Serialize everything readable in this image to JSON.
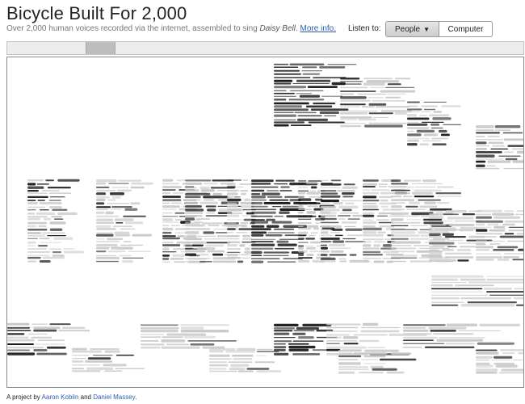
{
  "header": {
    "title": "Bicycle Built For 2,000",
    "subtitle_prefix": "Over 2,000 human voices recorded via the internet, assembled to sing ",
    "subtitle_song": "Daisy Bell",
    "subtitle_period": ".",
    "more_info_link": "More info."
  },
  "listen": {
    "label": "Listen to:",
    "options": [
      "People",
      "Computer"
    ],
    "selected": "People",
    "caret_icon": "▼"
  },
  "footer": {
    "prefix": "A project by ",
    "author1": "Aaron Koblin",
    "connector": " and ",
    "author2": "Daniel Massey",
    "suffix": "."
  },
  "colors": {
    "accent_link": "#2a5db0",
    "waveform_dark": "#1a1a1a",
    "waveform_light": "#c8c8c8",
    "frame_border": "#888888"
  }
}
